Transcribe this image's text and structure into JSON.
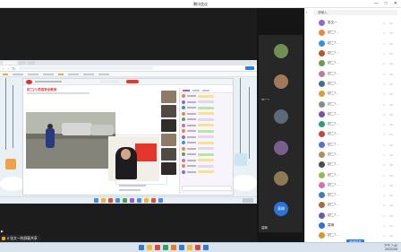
{
  "window": {
    "title": "腾讯会议",
    "controls": {
      "minimize": "—",
      "maximize": "□",
      "close": "✕"
    }
  },
  "share_tip": {
    "text": "8 张文一的屏幕共享"
  },
  "video_col": {
    "tiles": [
      {
        "name": "初二7 ...",
        "avatar_color": "#6f8f55"
      },
      {
        "name": "初二7 ...",
        "avatar_color": "#a07a58"
      },
      {
        "name": "初二7 ...",
        "avatar_color": "#5a6a7a"
      },
      {
        "name": "初二7 ...",
        "avatar_color": "#7a5f8c"
      },
      {
        "name": "初二7 ...",
        "avatar_color": "#8c7a52"
      },
      {
        "name": "莫琳",
        "avatar_text": "莫琳",
        "avatar_color": "#2a73d8"
      }
    ]
  },
  "panel": {
    "search_placeholder": "请输入",
    "participants": [
      {
        "name": "张文一",
        "color": "#8d6ad1"
      },
      {
        "name": "初二7 ...",
        "color": "#e7874b"
      },
      {
        "name": "初二7 ...",
        "color": "#3d8fd6"
      },
      {
        "name": "初二7 ...",
        "color": "#b8562a"
      },
      {
        "name": "初二7 ...",
        "color": "#6a9c4d"
      },
      {
        "name": "初二7 ...",
        "color": "#c27c9a"
      },
      {
        "name": "初二7 ...",
        "color": "#4b6d8c"
      },
      {
        "name": "初二7 ...",
        "color": "#d4a03a"
      },
      {
        "name": "初二7 ...",
        "color": "#8a8a8a"
      },
      {
        "name": "初二7 ...",
        "color": "#7a4fa8"
      },
      {
        "name": "初二7 ...",
        "color": "#2f9c7e"
      },
      {
        "name": "初二7 ...",
        "color": "#c6463a"
      },
      {
        "name": "初二7 ...",
        "color": "#5872c4"
      },
      {
        "name": "初二7 ...",
        "color": "#b58a5c"
      },
      {
        "name": "初二7 ...",
        "color": "#4c4c4c"
      },
      {
        "name": "初二7 ...",
        "color": "#9ab84e"
      },
      {
        "name": "初二7 ...",
        "color": "#e06fa5"
      },
      {
        "name": "初二7 ...",
        "color": "#3f7fb8"
      },
      {
        "name": "初二7 ...",
        "color": "#a36f3a"
      },
      {
        "name": "初二7 ...",
        "color": "#6b5aa8"
      },
      {
        "name": "莫琳",
        "color": "#2a73d8"
      },
      {
        "name": "初二7 ...",
        "color": "#d29a2e"
      }
    ],
    "invite_button": "邀请成员"
  },
  "host_tray": {
    "time": "下午 7:42",
    "date": "2022/2/8"
  },
  "remote": {
    "lesson_heading": "初二(7) 防疫安全教育"
  }
}
